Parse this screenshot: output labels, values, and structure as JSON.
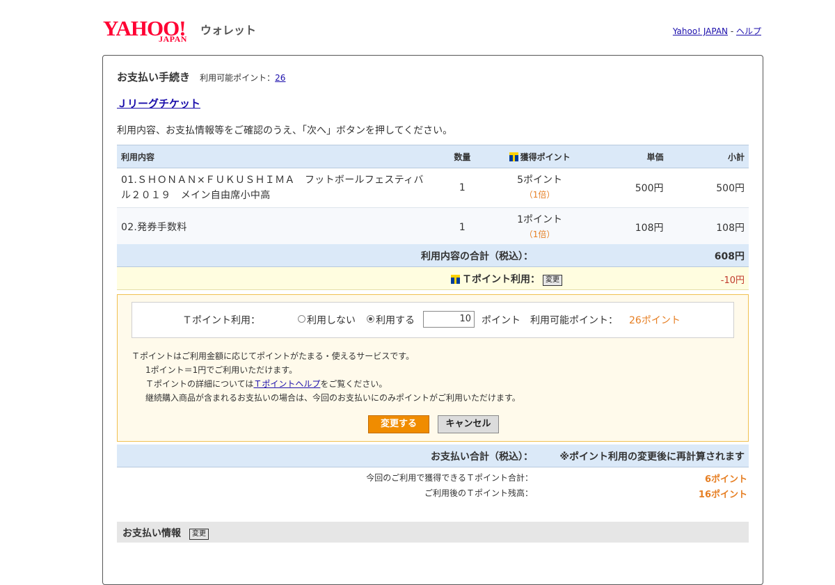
{
  "header": {
    "logo_text": "YAHOO!",
    "logo_sub": "JAPAN",
    "service_name": "ウォレット",
    "links": [
      {
        "label": "Yahoo! JAPAN"
      },
      {
        "label": "ヘルプ"
      }
    ],
    "separator": " - "
  },
  "page": {
    "title": "お支払い手続き",
    "available_points_label": "利用可能ポイント：",
    "available_points_value": "26",
    "service_link": "Ｊリーグチケット",
    "instruction": "利用内容、お支払情報等をご確認のうえ、「次へ」ボタンを押してください。"
  },
  "table": {
    "headers": {
      "item": "利用内容",
      "qty": "数量",
      "points": "獲得ポイント",
      "price": "単価",
      "subtotal": "小計"
    },
    "rows": [
      {
        "name_line1": "01.ＳＨＯＮＡＮ×ＦＵＫＵＳＨＩＭＡ　フットボールフェスティバ",
        "name_line2": "ル２０１９　メイン自由席小中高",
        "qty": "1",
        "points": "5ポイント",
        "rate": "（1倍）",
        "price": "500円",
        "subtotal": "500円"
      },
      {
        "name_line1": "02.発券手数料",
        "name_line2": "",
        "qty": "1",
        "points": "1ポイント",
        "rate": "（1倍）",
        "price": "108円",
        "subtotal": "108円"
      }
    ],
    "total_label": "利用内容の合計（税込）：",
    "total_value": "608円",
    "tpoint_label": "Ｔポイント利用：",
    "tpoint_change_button": "変更",
    "tpoint_value": "-10円"
  },
  "change_panel": {
    "label": "Ｔポイント利用：",
    "option_no": "利用しない",
    "option_yes": "利用する",
    "selected": "利用する",
    "input_value": "10",
    "unit": "ポイント",
    "available_label": "利用可能ポイント：",
    "available_value": "26ポイント",
    "notes": [
      "Ｔポイントはご利用金額に応じてポイントがたまる・使えるサービスです。",
      "1ポイント＝1円でご利用いただけます。",
      "Ｔポイントの詳細については",
      "Ｔポイントヘルプ",
      "をご覧ください。",
      "継続購入商品が含まれるお支払いの場合は、今回のお支払いにのみポイントがご利用いただけます。"
    ],
    "confirm_button": "変更する",
    "cancel_button": "キャンセル"
  },
  "payment_total": {
    "label": "お支払い合計（税込）：",
    "value": "※ポイント利用の変更後に再計算されます"
  },
  "summary": {
    "earned_label": "今回のご利用で獲得できるＴポイント合計：",
    "earned_value": "6ポイント",
    "balance_label": "ご利用後のＴポイント残高：",
    "balance_value": "16ポイント"
  },
  "payment_info": {
    "title": "お支払い情報",
    "change_button": "変更"
  },
  "colors": {
    "accent_orange": "#f08c00",
    "header_blue": "#dbe9f8",
    "logo_red": "#ff0033",
    "link_blue": "#1a0dab",
    "point_orange": "#e67e22"
  }
}
